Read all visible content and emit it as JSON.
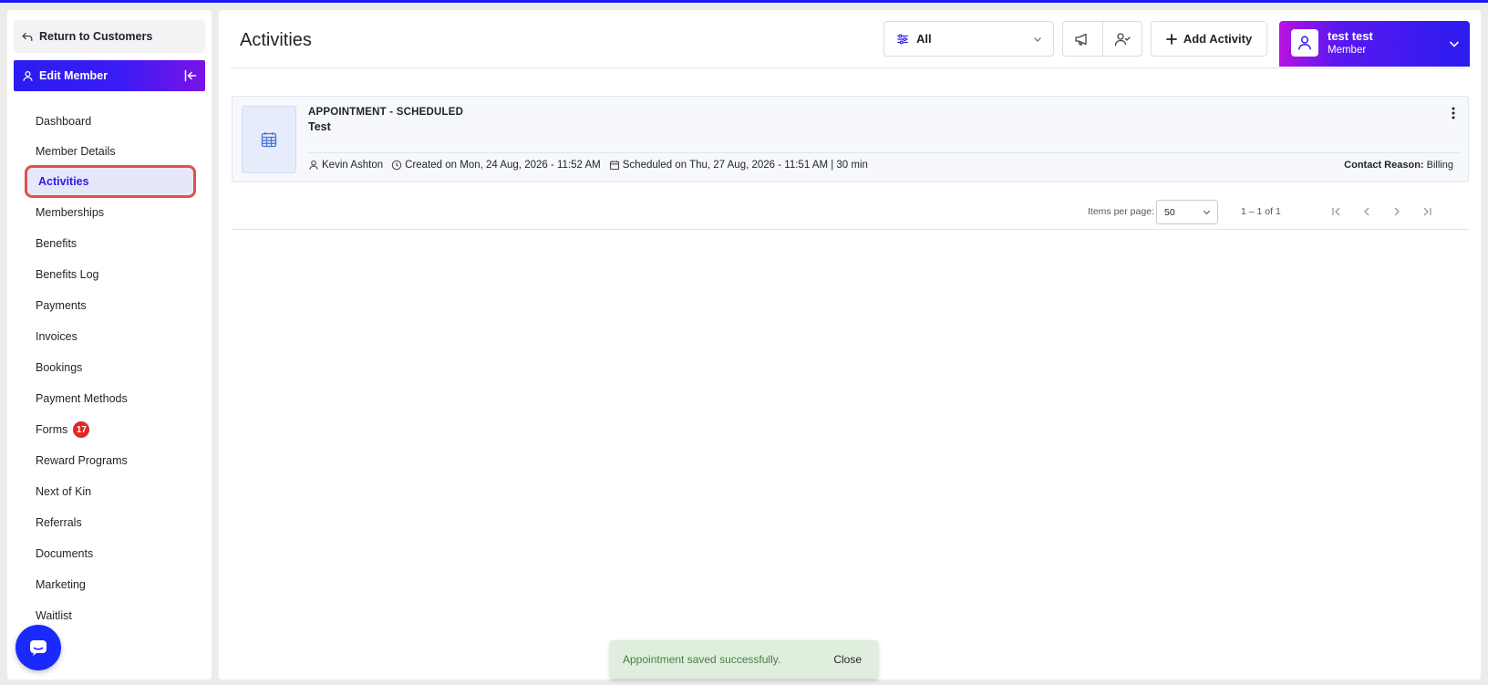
{
  "colors": {
    "accent": "#2a1cf0",
    "active_outline": "#e0524a",
    "badge": "#e02828",
    "toast_bg": "#dfeedd",
    "toast_text": "#4a7d48"
  },
  "sidebar": {
    "return_label": "Return to Customers",
    "section_label": "Edit Member",
    "items": [
      {
        "label": "Dashboard"
      },
      {
        "label": "Member Details"
      },
      {
        "label": "Activities",
        "active": true
      },
      {
        "label": "Memberships"
      },
      {
        "label": "Benefits"
      },
      {
        "label": "Benefits Log"
      },
      {
        "label": "Payments"
      },
      {
        "label": "Invoices"
      },
      {
        "label": "Bookings"
      },
      {
        "label": "Payment Methods"
      },
      {
        "label": "Forms",
        "badge": "17"
      },
      {
        "label": "Reward Programs"
      },
      {
        "label": "Next of Kin"
      },
      {
        "label": "Referrals"
      },
      {
        "label": "Documents"
      },
      {
        "label": "Marketing"
      },
      {
        "label": "Waitlist"
      }
    ]
  },
  "header": {
    "title": "Activities",
    "filter_value": "All",
    "add_activity_label": "Add Activity",
    "user_name": "test test",
    "user_role": "Member"
  },
  "activity": {
    "status": "APPOINTMENT - SCHEDULED",
    "title": "Test",
    "person": "Kevin Ashton",
    "created": "Created on Mon, 24 Aug, 2026 - 11:52 AM",
    "scheduled": "Scheduled on Thu, 27 Aug, 2026 - 11:51 AM | 30 min",
    "contact_reason_label": "Contact Reason:",
    "contact_reason_value": "Billing"
  },
  "paginator": {
    "items_per_page_label": "Items per page:",
    "page_size": "50",
    "range": "1 – 1 of 1"
  },
  "toast": {
    "message": "Appointment saved successfully.",
    "close_label": "Close"
  }
}
